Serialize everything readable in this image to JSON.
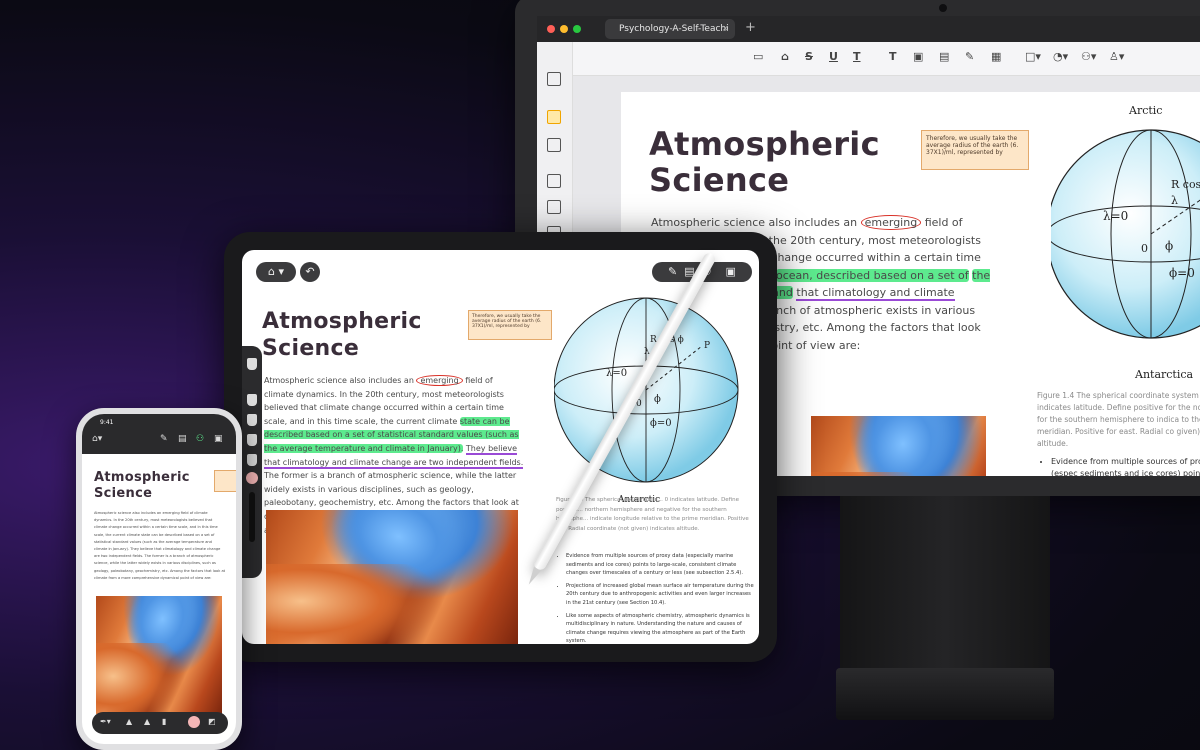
{
  "desktop": {
    "tab_title": "Psychology-A-Self-Teachi",
    "tab_close": "×",
    "new_tab": "+",
    "toolbar": [
      "S",
      "U",
      "T"
    ],
    "title_line1": "Atmospheric",
    "title_line2": "Science",
    "note": "Therefore, we usually take the average radius of the earth (6. 37X1)/ml, represented by",
    "body_p1": "Atmospheric science also includes an",
    "body_circled": "emerging",
    "body_p2": "field of climate dynamics. In the 20th century, most meteorologists believed that climate change occurred within a certain time scale, and in this time",
    "body_hl1": "ocean, described based on a set of",
    "body_hl2": "the average temperature and",
    "body_ul": "that climatology and climate change",
    "body_p3": "former is a branch of atmospheric exists in various disciplines, such as mistry, etc. Among the factors that look ehensive dynamical point of view are:",
    "sphere_top": "Arctic",
    "sphere_bottom": "Antarctica",
    "caption": "Figure 1.4 The spherical coordinate system in at 0 indicates latitude. Define positive for the north negative for the southern hemisphere to indica to the prime meridian. Positive for east. Radial co given) indicates altitude.",
    "bullet": "Evidence from multiple sources of proxy data (espec sediments and ice cores) points to large-scale, cons over timescales of a century or less (see subsection"
  },
  "tablet": {
    "title_line1": "Atmospheric",
    "title_line2": "Science",
    "note": "Therefore, we usually take the average radius of the earth (6. 37X1)/ml, represented by",
    "p_intro": "Atmospheric science also includes an",
    "p_circled": "emerging",
    "p_after": "field of climate dynamics. In the 20th century, most meteorologists believed that climate change occurred within a certain time scale, and in this time scale, the current climate",
    "hl": "state can be described based on a set of statistical standard values (such as the average temperature and climate in January).",
    "ul": "They believe that climatology and climate change are two independent fields.",
    "p_end": "The former is a branch of atmospheric science, while the latter widely exists in various disciplines, such as geology, paleobotany, geochemistry, etc. Among the factors that look at climate from a more comprehensive dynamical point of view are:",
    "sphere_bottom": "Antarctic",
    "caption": "Figure 1.4 The spherical coordinate s... 0 indicates latitude. Define positive... northern hemisphere and negative for the southern hemisphe... indicate longitude relative to the prime meridian. Positive fo... Radial coordinate (not given) indicates altitude.",
    "bullet1": "Evidence from multiple sources of proxy data (especially marine sediments and ice cores) points to large-scale, consistent climate changes over timescales of a century or less (see subsection 2.5.4).",
    "bullet2": "Projections of increased global mean surface air temperature during the 20th century due to anthropogenic activities and even larger increases in the 21st century (see Section 10.4).",
    "bullet3": "Like some aspects of atmospheric chemistry, atmospheric dynamics is multidisciplinary in nature. Understanding the nature and causes of climate change requires viewing the atmosphere as part of the Earth system."
  },
  "phone": {
    "time": "9:41",
    "title_line1": "Atmospheric",
    "title_line2": "Science",
    "body": "Atmospheric science also includes an emerging field of climate dynamics. In the 20th century, most meteorologists believed that climate change occurred within a certain time scale, and in this time scale, the current climate state can be described based on a set of statistical standard values (such as the average temperature and climate in January). They believe that climatology and climate change are two independent fields. The former is a branch of atmospheric science, while the latter widely exists in various disciplines, such as geology, paleobotany, geochemistry, etc. Among the factors that look at climate from a more comprehensive dynamical point of view are:"
  }
}
